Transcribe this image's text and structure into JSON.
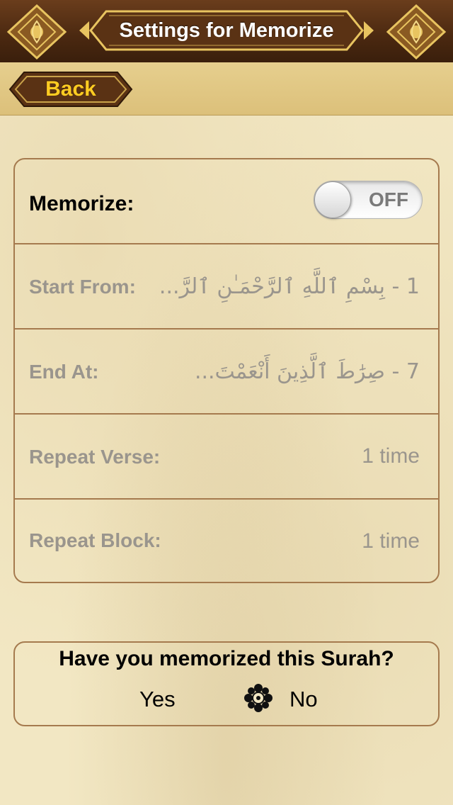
{
  "header": {
    "title": "Settings for Memorize",
    "left_icon": "ornament-icon",
    "right_icon": "ornament-icon"
  },
  "nav": {
    "back_label": "Back"
  },
  "settings": {
    "memorize": {
      "label": "Memorize:",
      "toggle_state": "OFF"
    },
    "start_from": {
      "label": "Start From:",
      "value": "1 - بِسْمِ ٱللَّهِ ٱلرَّحْمَـٰنِ ٱلرَّ..."
    },
    "end_at": {
      "label": "End At:",
      "value": "7 - صِرَٰطَ ٱلَّذِينَ أَنْعَمْتَ..."
    },
    "repeat_verse": {
      "label": "Repeat Verse:",
      "value": "1 time"
    },
    "repeat_block": {
      "label": "Repeat Block:",
      "value": "1 time"
    }
  },
  "question": {
    "text": "Have you memorized this Surah?",
    "yes_label": "Yes",
    "no_label": "No",
    "selected_icon": "flower-icon",
    "selected": "No"
  },
  "colors": {
    "header_brown": "#4a2810",
    "accent_gold": "#ffcc22",
    "border": "#a57a4e",
    "disabled_text": "#9a958d"
  }
}
